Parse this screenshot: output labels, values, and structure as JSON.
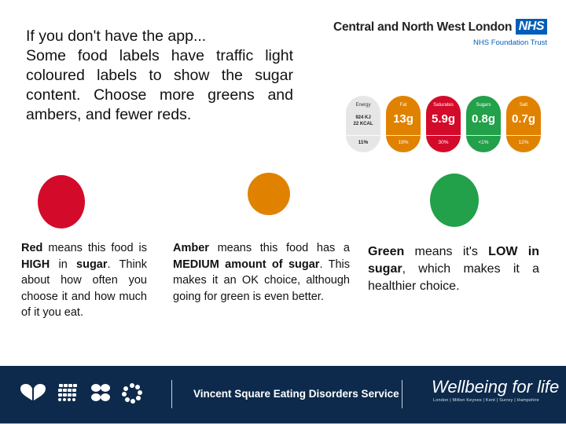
{
  "intro": {
    "line1": "If you don't have the app...",
    "line2": "Some food labels have traffic light coloured labels to show the sugar content. Choose more greens and ambers, and fewer reds."
  },
  "logo": {
    "organisation": "Central and North West London",
    "nhs_badge": "NHS",
    "subtitle": "NHS Foundation Trust"
  },
  "nutrition_label": {
    "items": [
      {
        "name": "Energy",
        "sub1": "924 KJ",
        "sub2": "22 KCAL",
        "amount": "",
        "percent": "11%",
        "status": "none"
      },
      {
        "name": "Fat",
        "amount": "13g",
        "percent": "19%",
        "status": "amber"
      },
      {
        "name": "Saturates",
        "amount": "5.9g",
        "percent": "30%",
        "status": "red"
      },
      {
        "name": "Sugars",
        "amount": "0.8g",
        "percent": "<1%",
        "status": "green"
      },
      {
        "name": "Salt",
        "amount": "0.7g",
        "percent": "12%",
        "status": "amber"
      }
    ]
  },
  "colors": {
    "red": "#d40a2a",
    "amber": "#e08200",
    "green": "#22a04a",
    "energy": "#e6e6e6",
    "footer": "#0d2a4c",
    "nhs_blue": "#005eb8"
  },
  "descriptions": {
    "red": {
      "b1": "Red",
      "t1": " means this food is ",
      "b2": "HIGH",
      "t2": " in ",
      "b3": "sugar",
      "t3": ". Think about how often you choose it and how much of it you eat."
    },
    "amber": {
      "b1": "Amber",
      "t1": " means this food has a ",
      "b2": "MEDIUM amount of sugar",
      "t2": ". This makes it an OK choice, although going for green is even better."
    },
    "green": {
      "b1": "Green",
      "t1": " means it's ",
      "b2": "LOW in sugar",
      "t2": ", which makes it a healthier choice."
    }
  },
  "footer": {
    "service": "Vincent Square Eating Disorders Service",
    "tagline": "Wellbeing for life",
    "places": "London | Milton Keynes | Kent | Surrey | Hampshire",
    "icons": [
      "heart-icon",
      "grid-dots-icon",
      "flower-icon",
      "ring-dots-icon"
    ]
  }
}
